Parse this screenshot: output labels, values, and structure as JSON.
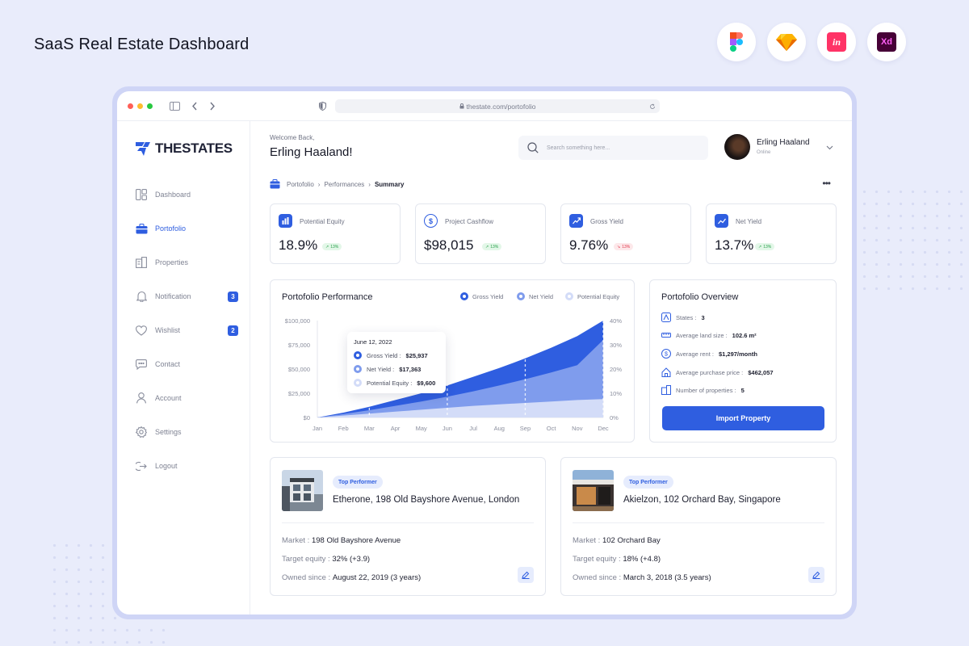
{
  "page": {
    "title": "SaaS Real Estate Dashboard"
  },
  "tools": [
    "figma-icon",
    "sketch-icon",
    "invision-icon",
    "xd-icon"
  ],
  "browser": {
    "url": "thestate.com/portofolio"
  },
  "app": {
    "logo_text": "THESTATES",
    "accent": "#2f5ee0"
  },
  "sidebar": {
    "items": [
      {
        "label": "Dashboard",
        "icon": "dashboard-icon"
      },
      {
        "label": "Portofolio",
        "icon": "briefcase-icon",
        "active": true
      },
      {
        "label": "Properties",
        "icon": "building-icon"
      },
      {
        "label": "Notification",
        "icon": "bell-icon",
        "badge": "3"
      },
      {
        "label": "Wishlist",
        "icon": "heart-icon",
        "badge": "2"
      },
      {
        "label": "Contact",
        "icon": "chat-icon"
      },
      {
        "label": "Account",
        "icon": "user-icon"
      },
      {
        "label": "Settings",
        "icon": "gear-icon"
      },
      {
        "label": "Logout",
        "icon": "logout-icon"
      }
    ]
  },
  "header": {
    "welcome": "Welcome Back,",
    "user_name": "Erling Haaland!",
    "search_placeholder": "Search something here...",
    "profile_name": "Erling Haaland",
    "profile_status": "Online"
  },
  "breadcrumb": {
    "items": [
      "Portofolio",
      "Performances"
    ],
    "current": "Summary"
  },
  "stats": [
    {
      "label": "Potential Equity",
      "value": "18.9%",
      "change": "13%",
      "trend": "up"
    },
    {
      "label": "Project Cashflow",
      "value": "$98,015",
      "change": "13%",
      "trend": "up"
    },
    {
      "label": "Gross Yield",
      "value": "9.76%",
      "change": "13%",
      "trend": "down"
    },
    {
      "label": "Net Yield",
      "value": "13.7%",
      "change": "13%",
      "trend": "up"
    }
  ],
  "performance": {
    "title": "Portofolio Performance",
    "legend": [
      "Gross Yield",
      "Net Yield",
      "Potential Equity"
    ],
    "tooltip": {
      "date": "June 12, 2022",
      "rows": [
        {
          "label": "Gross Yield :",
          "value": "$25,937"
        },
        {
          "label": "Net Yield :",
          "value": "$17,363"
        },
        {
          "label": "Potential Equity :",
          "value": "$9,600"
        }
      ]
    }
  },
  "chart_data": {
    "type": "area",
    "categories": [
      "Jan",
      "Feb",
      "Mar",
      "Apr",
      "May",
      "Jun",
      "Jul",
      "Aug",
      "Sep",
      "Oct",
      "Nov",
      "Dec"
    ],
    "y_ticks": [
      "$100,000",
      "$75,000",
      "$50,000",
      "$25,000",
      "$0"
    ],
    "y2_ticks": [
      "40%",
      "30%",
      "20%",
      "10%",
      "0%"
    ],
    "ylim": [
      0,
      100000
    ],
    "series": [
      {
        "name": "Gross Yield",
        "color": "#2f5ee0",
        "values": [
          0,
          5000,
          11000,
          18000,
          25000,
          33000,
          42000,
          51000,
          61000,
          72000,
          84000,
          100000
        ]
      },
      {
        "name": "Net Yield",
        "color": "#7f9ced",
        "values": [
          0,
          3500,
          7500,
          12000,
          16500,
          21500,
          27000,
          33000,
          39500,
          46500,
          54000,
          80000
        ]
      },
      {
        "name": "Potential Equity",
        "color": "#d3dcf8",
        "values": [
          0,
          2000,
          4000,
          6000,
          8000,
          10000,
          12000,
          13500,
          15000,
          16500,
          18000,
          19000
        ]
      }
    ]
  },
  "overview": {
    "title": "Portofolio Overview",
    "rows": [
      {
        "label": "States :",
        "value": "3",
        "icon": "map-icon"
      },
      {
        "label": "Average land size :",
        "value": "102.6 m²",
        "icon": "ruler-icon"
      },
      {
        "label": "Average rent :",
        "value": "$1,297/month",
        "icon": "dollar-icon"
      },
      {
        "label": "Average purchase price :",
        "value": "$462,057",
        "icon": "home-icon"
      },
      {
        "label": "Number of properties :",
        "value": "5",
        "icon": "building-icon"
      }
    ],
    "button": "Import Property"
  },
  "properties": [
    {
      "tag": "Top Performer",
      "title": "Etherone, 198 Old Bayshore Avenue, London",
      "market_label": "Market :",
      "market": "198 Old Bayshore Avenue",
      "equity_label": "Target equity :",
      "equity": "32% (+3.9)",
      "owned_label": "Owned since :",
      "owned": "August 22, 2019 (3 years)"
    },
    {
      "tag": "Top Performer",
      "title": "Akielzon, 102 Orchard Bay, Singapore",
      "market_label": "Market :",
      "market": "102 Orchard Bay",
      "equity_label": "Target equity :",
      "equity": "18% (+4.8)",
      "owned_label": "Owned since :",
      "owned": "March 3, 2018 (3.5 years)"
    }
  ]
}
